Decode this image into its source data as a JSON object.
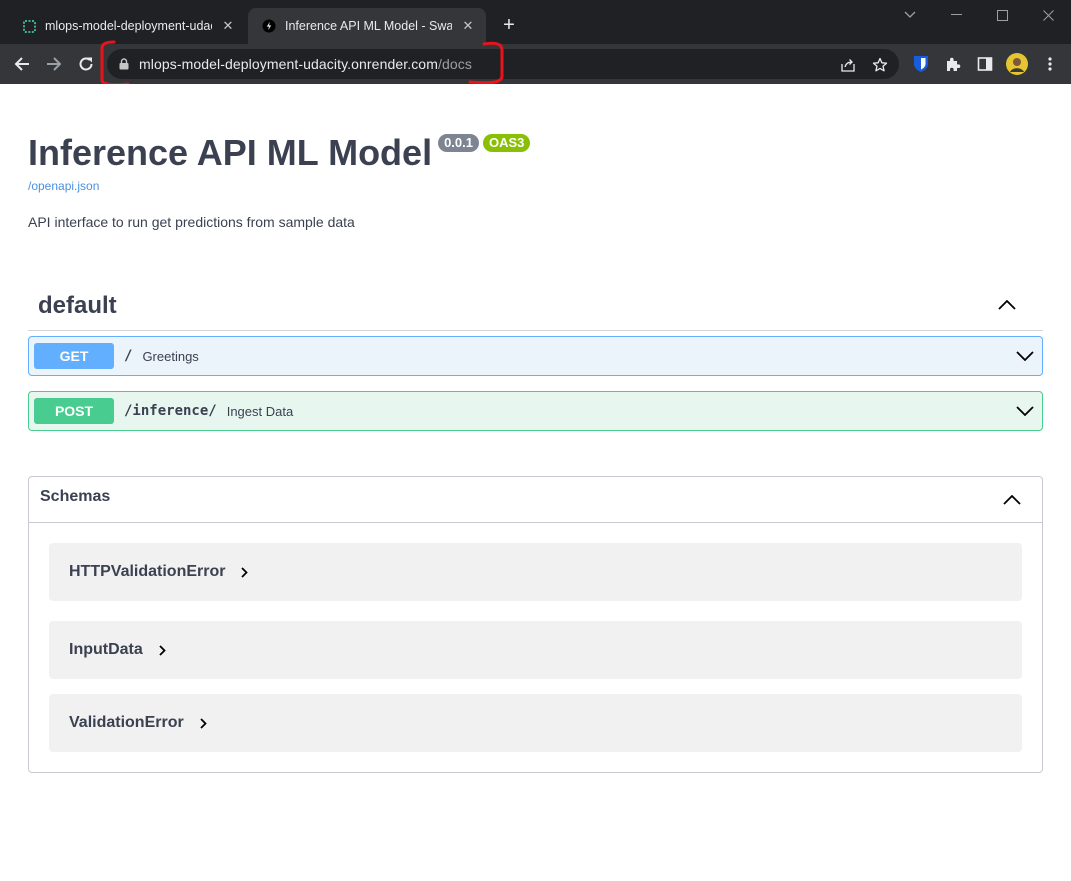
{
  "browser": {
    "tabs": [
      {
        "title": "mlops-model-deployment-udacity",
        "active": false,
        "favicon": "render-icon"
      },
      {
        "title": "Inference API ML Model - Swagger UI",
        "active": true,
        "favicon": "swagger-icon"
      }
    ],
    "address": {
      "host": "mlops-model-deployment-udacity.onrender.com",
      "path": "/docs"
    },
    "annotation_color": "#e8141b"
  },
  "info": {
    "title": "Inference API ML Model",
    "version": "0.0.1",
    "oas_badge": "OAS3",
    "spec_link": "/openapi.json",
    "description": "API interface to run get predictions from sample data"
  },
  "tag": {
    "name": "default"
  },
  "operations": [
    {
      "method": "GET",
      "path": "/",
      "summary": "Greetings",
      "color": "#61affe"
    },
    {
      "method": "POST",
      "path": "/inference/",
      "summary": "Ingest Data",
      "color": "#49cc90"
    }
  ],
  "schemas": {
    "label": "Schemas",
    "items": [
      "HTTPValidationError",
      "InputData",
      "ValidationError"
    ]
  }
}
